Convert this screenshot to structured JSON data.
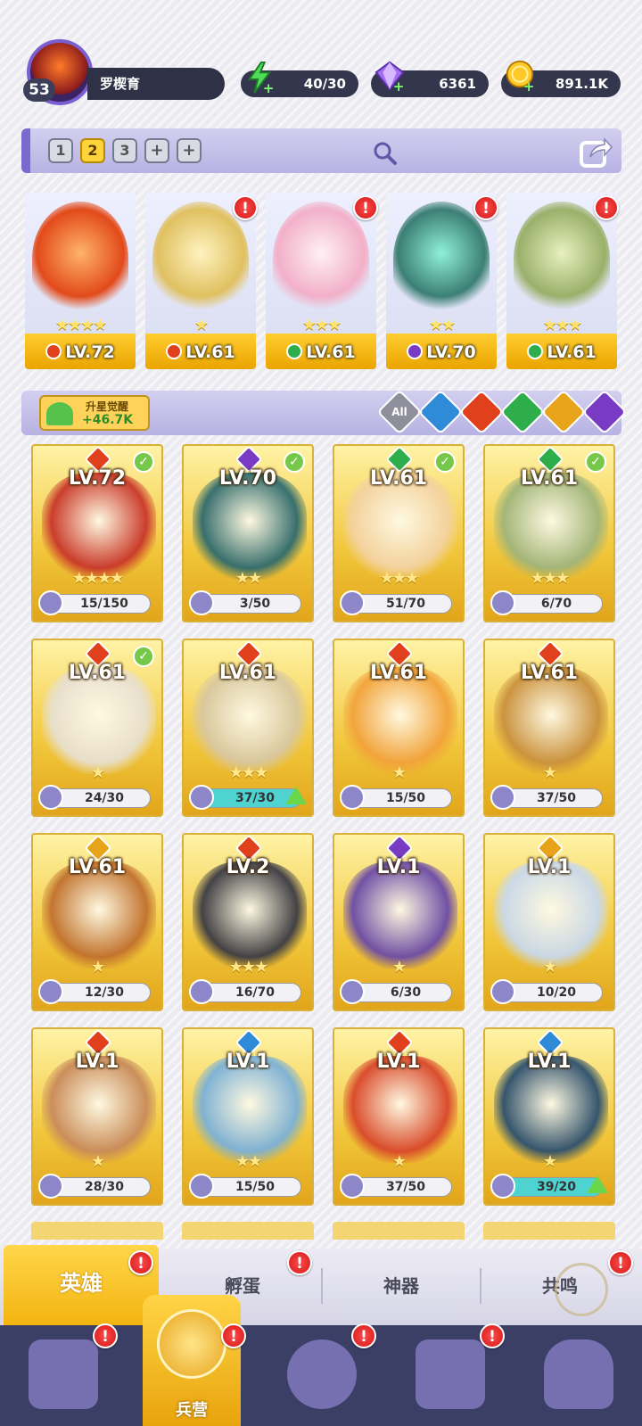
{
  "player": {
    "level": "53",
    "name": "罗楔育"
  },
  "resources": {
    "energy": "40/30",
    "gems": "6361",
    "gold": "891.1K"
  },
  "teams": {
    "slots": [
      "1",
      "2",
      "3",
      "+",
      "+"
    ],
    "active": 1
  },
  "team_heroes": [
    {
      "stars": "★★★★",
      "lv": "LV.72",
      "element": "fire",
      "color": "#e24a1a"
    },
    {
      "stars": "★",
      "lv": "LV.61",
      "element": "fire",
      "color": "#e0c060"
    },
    {
      "stars": "★★★",
      "lv": "LV.61",
      "element": "nature",
      "color": "#f2b0c8"
    },
    {
      "stars": "★★",
      "lv": "LV.70",
      "element": "dark",
      "color": "#3c7f74"
    },
    {
      "stars": "★★★",
      "lv": "LV.61",
      "element": "nature",
      "color": "#9ab06a"
    }
  ],
  "awaken": {
    "title": "升星觉醒",
    "value": "+46.7K"
  },
  "filters": [
    "All",
    "water",
    "fire",
    "nature",
    "light",
    "dark"
  ],
  "heroes": [
    {
      "lv": "LV.72",
      "element": "fire",
      "stars": "★★★★",
      "progress": "15/150",
      "checked": true,
      "full": false,
      "art": "#c8352a"
    },
    {
      "lv": "LV.70",
      "element": "dark",
      "stars": "★★",
      "progress": "3/50",
      "checked": true,
      "full": false,
      "art": "#2e6a6e"
    },
    {
      "lv": "LV.61",
      "element": "nature",
      "stars": "★★★",
      "progress": "51/70",
      "checked": true,
      "full": false,
      "art": "#f3d2a0"
    },
    {
      "lv": "LV.61",
      "element": "nature",
      "stars": "★★★",
      "progress": "6/70",
      "checked": true,
      "full": false,
      "art": "#9fb47a"
    },
    {
      "lv": "LV.61",
      "element": "fire",
      "stars": "★",
      "progress": "24/30",
      "checked": true,
      "full": false,
      "art": "#e7e0d0"
    },
    {
      "lv": "LV.61",
      "element": "fire",
      "stars": "★★★",
      "progress": "37/30",
      "checked": false,
      "full": true,
      "art": "#d8c7a0"
    },
    {
      "lv": "LV.61",
      "element": "fire",
      "stars": "★",
      "progress": "15/50",
      "checked": false,
      "full": false,
      "art": "#f2a23a"
    },
    {
      "lv": "LV.61",
      "element": "fire",
      "stars": "★",
      "progress": "37/50",
      "checked": false,
      "full": false,
      "art": "#c9903e"
    },
    {
      "lv": "LV.61",
      "element": "light",
      "stars": "★",
      "progress": "12/30",
      "checked": false,
      "full": false,
      "art": "#c0702e"
    },
    {
      "lv": "LV.2",
      "element": "fire",
      "stars": "★★★",
      "progress": "16/70",
      "checked": false,
      "full": false,
      "art": "#3a3a44"
    },
    {
      "lv": "LV.1",
      "element": "dark",
      "stars": "★",
      "progress": "6/30",
      "checked": false,
      "full": false,
      "art": "#6a4aa8"
    },
    {
      "lv": "LV.1",
      "element": "light",
      "stars": "★",
      "progress": "10/20",
      "checked": false,
      "full": false,
      "art": "#c8d8ec"
    },
    {
      "lv": "LV.1",
      "element": "fire",
      "stars": "★",
      "progress": "28/30",
      "checked": false,
      "full": false,
      "art": "#c88a5a"
    },
    {
      "lv": "LV.1",
      "element": "water",
      "stars": "★★",
      "progress": "15/50",
      "checked": false,
      "full": false,
      "art": "#7ab0d8"
    },
    {
      "lv": "LV.1",
      "element": "fire",
      "stars": "★",
      "progress": "37/50",
      "checked": false,
      "full": false,
      "art": "#d8462a"
    },
    {
      "lv": "LV.1",
      "element": "water",
      "stars": "★",
      "progress": "39/20",
      "checked": false,
      "full": true,
      "art": "#2c4f6e"
    }
  ],
  "element_colors": {
    "fire": "#e0401c",
    "water": "#2f8ad8",
    "nature": "#2eae4a",
    "light": "#e7a41a",
    "dark": "#7a3bc4"
  },
  "tabs": {
    "heroes": "英雄",
    "hatch": "孵蛋",
    "artifact": "神器",
    "resonance": "共鸣"
  },
  "nav": {
    "barracks": "兵营"
  },
  "alert": "!"
}
